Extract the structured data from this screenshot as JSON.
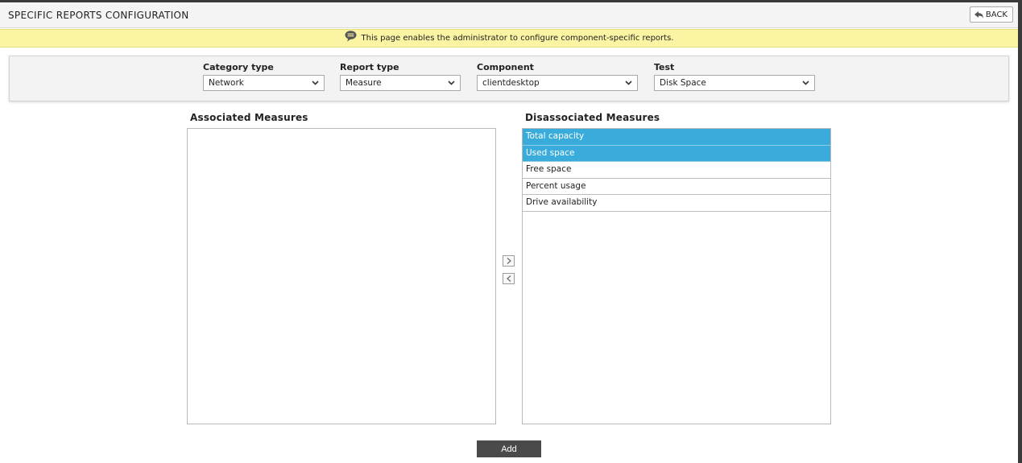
{
  "header": {
    "title": "SPECIFIC REPORTS CONFIGURATION",
    "back_label": "BACK"
  },
  "info": {
    "message": "This page enables the administrator to configure component-specific reports."
  },
  "filters": {
    "category": {
      "label": "Category type",
      "value": "Network"
    },
    "report": {
      "label": "Report type",
      "value": "Measure"
    },
    "component": {
      "label": "Component",
      "value": "clientdesktop"
    },
    "test": {
      "label": "Test",
      "value": "Disk Space"
    }
  },
  "associated": {
    "title": "Associated Measures",
    "items": []
  },
  "disassociated": {
    "title": "Disassociated Measures",
    "items": [
      {
        "label": "Total capacity",
        "selected": true
      },
      {
        "label": "Used space",
        "selected": true
      },
      {
        "label": "Free space",
        "selected": false
      },
      {
        "label": "Percent usage",
        "selected": false
      },
      {
        "label": "Drive availability",
        "selected": false
      }
    ]
  },
  "actions": {
    "add_label": "Add"
  },
  "icons": {
    "back": "back-arrow-icon",
    "info": "speech-bubble-icon",
    "dropdown": "chevron-down-icon",
    "move_right": "chevron-right-icon",
    "move_left": "chevron-left-icon"
  },
  "colors": {
    "info_bar": "#fbf4a3",
    "selected_item": "#3aacdc",
    "add_button": "#4a4a4a"
  }
}
